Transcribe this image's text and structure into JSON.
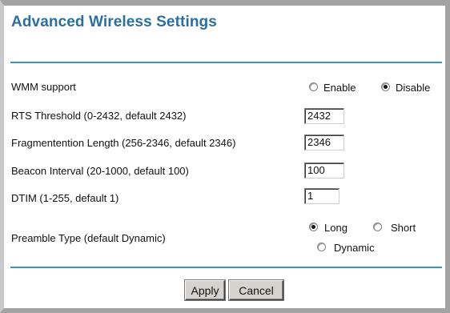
{
  "page": {
    "title": "Advanced Wireless Settings"
  },
  "wmm": {
    "label": "WMM support",
    "options": [
      "Enable",
      "Disable"
    ],
    "selected": "Disable"
  },
  "rts": {
    "label": "RTS Threshold (0-2432, default 2432)",
    "value": "2432"
  },
  "frag": {
    "label": "Fragmentention Length (256-2346, default 2346)",
    "value": "2346"
  },
  "beacon": {
    "label": "Beacon Interval (20-1000, default 100)",
    "value": "100"
  },
  "dtim": {
    "label": "DTIM (1-255, default 1)",
    "value": "1"
  },
  "preamble": {
    "label": "Preamble Type (default Dynamic)",
    "options": [
      "Long",
      "Short",
      "Dynamic"
    ],
    "selected": "Long"
  },
  "buttons": {
    "apply": "Apply",
    "cancel": "Cancel"
  },
  "colors": {
    "title": "#2a6fa0",
    "rule": "#3a93c9",
    "frame": "#a3a3a3",
    "button": "#d6d3ce"
  }
}
